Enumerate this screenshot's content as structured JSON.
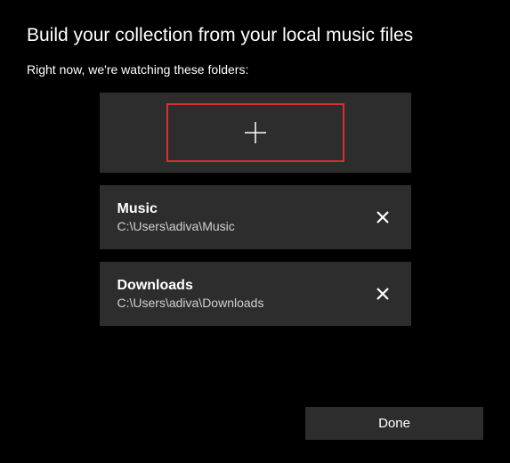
{
  "header": {
    "title": "Build your collection from your local music files",
    "subtitle": "Right now, we're watching these folders:"
  },
  "folders": [
    {
      "name": "Music",
      "path": "C:\\Users\\adiva\\Music"
    },
    {
      "name": "Downloads",
      "path": "C:\\Users\\adiva\\Downloads"
    }
  ],
  "actions": {
    "done_label": "Done"
  }
}
